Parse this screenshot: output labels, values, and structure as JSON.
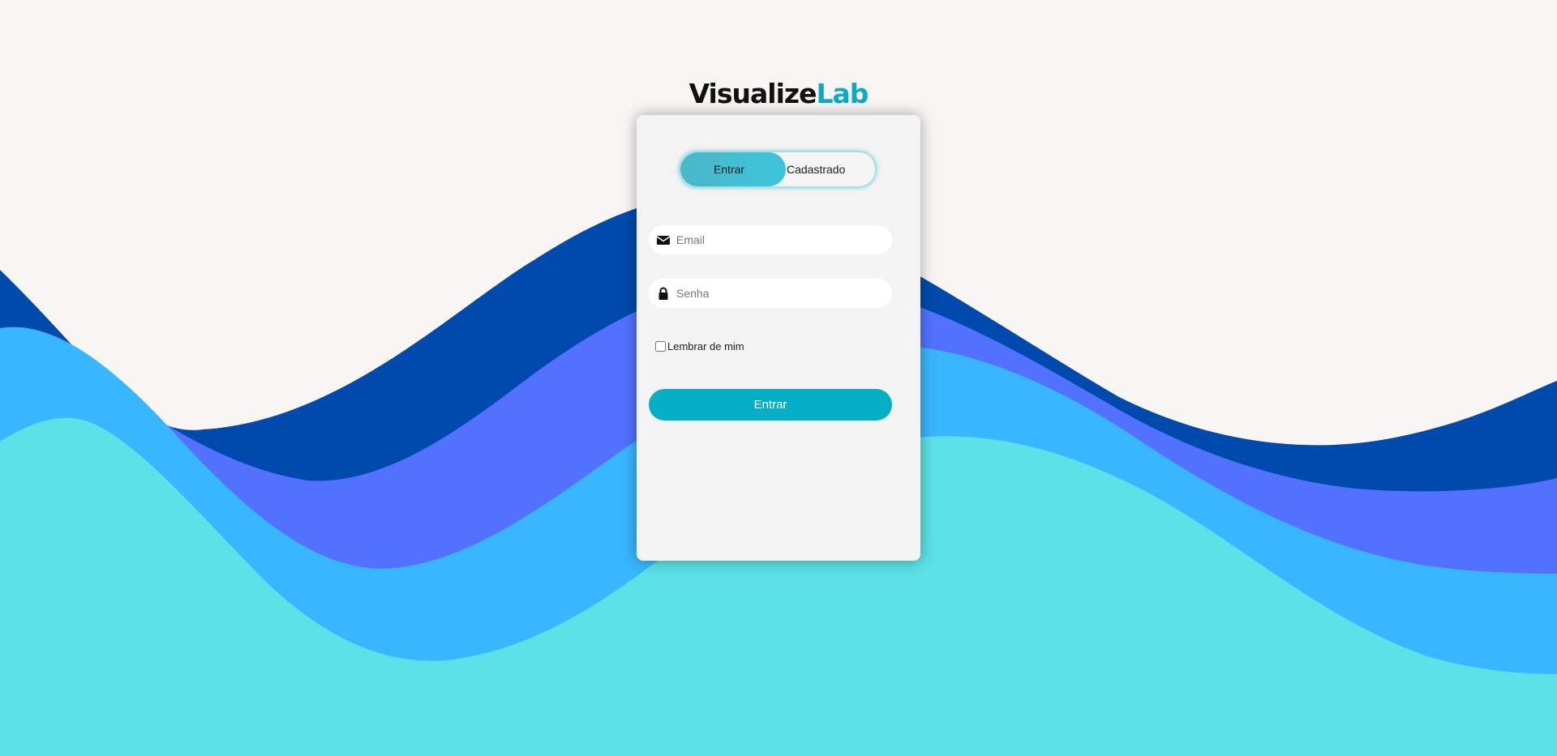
{
  "brand": {
    "part1": "Visualize",
    "part2": "Lab"
  },
  "colors": {
    "background": "#f8f6f2",
    "wave_dark_blue": "#004aad",
    "wave_periwinkle": "#5271ff",
    "wave_sky": "#38b6ff",
    "wave_cyan": "#5ce1e6",
    "accent": "#04afc6"
  },
  "toggle": {
    "login_label": "Entrar",
    "signup_label": "Cadastrado",
    "selected": "Entrar"
  },
  "form": {
    "email_placeholder": "Email",
    "email_value": "",
    "email_icon": "envelope-icon",
    "password_placeholder": "Senha",
    "password_value": "",
    "password_icon": "lock-icon",
    "remember_label": "Lembrar de mim",
    "remember_checked": false,
    "submit_label": "Entrar"
  }
}
